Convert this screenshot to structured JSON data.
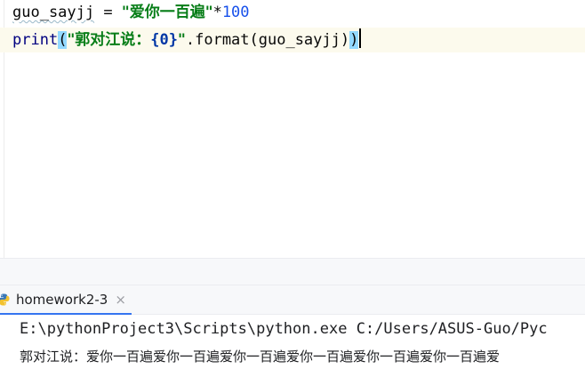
{
  "editor": {
    "line1": {
      "var": "guo_sayjj",
      "op": " = ",
      "str": "\"爱你一百遍\"",
      "mul": "*",
      "num": "100"
    },
    "line2": {
      "fn": "print",
      "lparen": "(",
      "str_a": "\"郭对江说：",
      "fmt": "{0}",
      "str_b": "\"",
      "method": ".format(guo_sayjj)",
      "rparen": ")"
    }
  },
  "run": {
    "tab_label": "homework2-3",
    "close_glyph": "×",
    "command": "E:\\pythonProject3\\Scripts\\python.exe C:/Users/ASUS-Guo/Pyc",
    "output": "郭对江说：爱你一百遍爱你一百遍爱你一百遍爱你一百遍爱你一百遍爱你一百遍爱"
  },
  "icons": {
    "tab_icon": "python-icon",
    "close": "close-icon"
  },
  "colors": {
    "accent": "#3574f0",
    "string": "#067d17",
    "number": "#1750eb",
    "paren_highlight": "#93d9ff"
  }
}
